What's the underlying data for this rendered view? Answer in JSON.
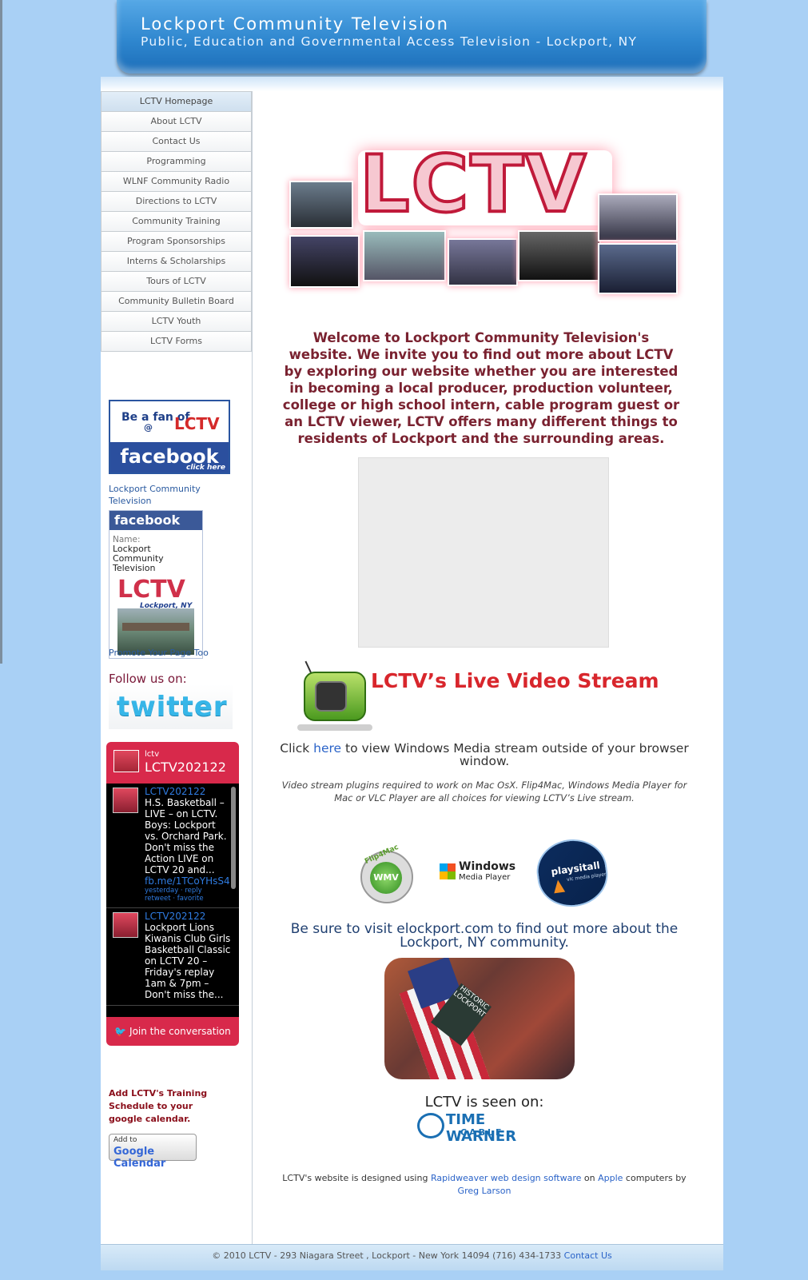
{
  "header": {
    "title": "Lockport Community Television",
    "subtitle": "Public, Education and Governmental Access Television - Lockport, NY"
  },
  "nav": {
    "items": [
      {
        "label": "LCTV Homepage"
      },
      {
        "label": "About LCTV"
      },
      {
        "label": "Contact Us"
      },
      {
        "label": "Programming"
      },
      {
        "label": "WLNF Community Radio"
      },
      {
        "label": "Directions to LCTV"
      },
      {
        "label": "Community Training"
      },
      {
        "label": "Program Sponsorships"
      },
      {
        "label": "Interns & Scholarships"
      },
      {
        "label": "Tours of LCTV"
      },
      {
        "label": "Community Bulletin Board"
      },
      {
        "label": "LCTV Youth"
      },
      {
        "label": "LCTV Forms"
      }
    ]
  },
  "fan_badge": {
    "be": "Be a fan of",
    "at": "@",
    "lctv": "LCTV",
    "facebook": "facebook",
    "click": "click here"
  },
  "facebook_widget": {
    "page_link": "Lockport Community Television",
    "brand": "facebook",
    "name_label": "Name:",
    "name_value": "Lockport Community Television",
    "logo_text": "LCTV",
    "logo_sub": "Lockport, NY",
    "promote": "Promote Your Page Too"
  },
  "follow": {
    "label": "Follow us on:",
    "twitter": "twitter"
  },
  "twitter_widget": {
    "small": "lctv",
    "handle": "LCTV202122",
    "tweets": [
      {
        "user": "LCTV202122",
        "text": "H.S. Basketball – LIVE – on LCTV. Boys: Lockport vs. Orchard Park. Don't miss the Action LIVE on LCTV 20 and...",
        "link": "fb.me/1TCoYHsS4",
        "meta_time": "yesterday",
        "meta_reply": "reply",
        "meta_retweet": "retweet",
        "meta_favorite": "favorite"
      },
      {
        "user": "LCTV202122",
        "text": "Lockport Lions Kiwanis Club Girls Basketball Classic on LCTV 20 – Friday's replay 1am & 7pm – Don't miss the..."
      }
    ],
    "join": "Join the conversation"
  },
  "calendar": {
    "text": "Add LCTV's Training Schedule to your google calendar.",
    "btn_add": "Add to",
    "btn_label": "Google Calendar"
  },
  "main": {
    "banner_text": "LCTV",
    "welcome": "Welcome to Lockport Community Television's website. We invite you to find out more about LCTV by exploring our website whether you are interested in becoming a local producer, production volunteer, college or high school intern, cable program guest or an LCTV viewer, LCTV offers many different things to residents of Lockport and the surrounding areas.",
    "live_title": "LCTV’s Live Video Stream",
    "click_pre": "Click ",
    "click_link": "here",
    "click_post": " to view Windows Media stream outside of your browser window.",
    "plugins_note": "Video stream plugins required to work on Mac OsX. Flip4Mac, Windows Media Player for Mac or VLC Player are all choices for viewing LCTV’s Live stream.",
    "flip4mac_label": "Flip4Mac",
    "flip4mac_core": "WMV",
    "wmp_line1": "Windows",
    "wmp_line2": "Media Player",
    "vlc_label": "playsitall",
    "vlc_sub": "vlc media player",
    "elockport": "Be sure to visit elockport.com to find out more about the Lockport, NY community.",
    "historic_sign": "HISTORIC LOCKPORT",
    "seen_on": "LCTV is seen on:",
    "twc_line1": "TIME WARNER",
    "twc_line2": "CABLE",
    "credits_pre": "LCTV's website is designed using ",
    "credits_link1": "Rapidweaver web design software",
    "credits_mid": " on ",
    "credits_link2": "Apple",
    "credits_post": " computers by ",
    "credits_link3": "Greg Larson"
  },
  "footer": {
    "text": "© 2010 LCTV - 293 Niagara Street , Lockport - New York 14094 (716) 434-1733 ",
    "link": "Contact Us"
  },
  "colors": {
    "background": "#a9d0f5",
    "header_blue": "#2f87cf",
    "welcome_text": "#7a2230",
    "live_red": "#d8262c",
    "twitter_widget": "#d8294b"
  }
}
